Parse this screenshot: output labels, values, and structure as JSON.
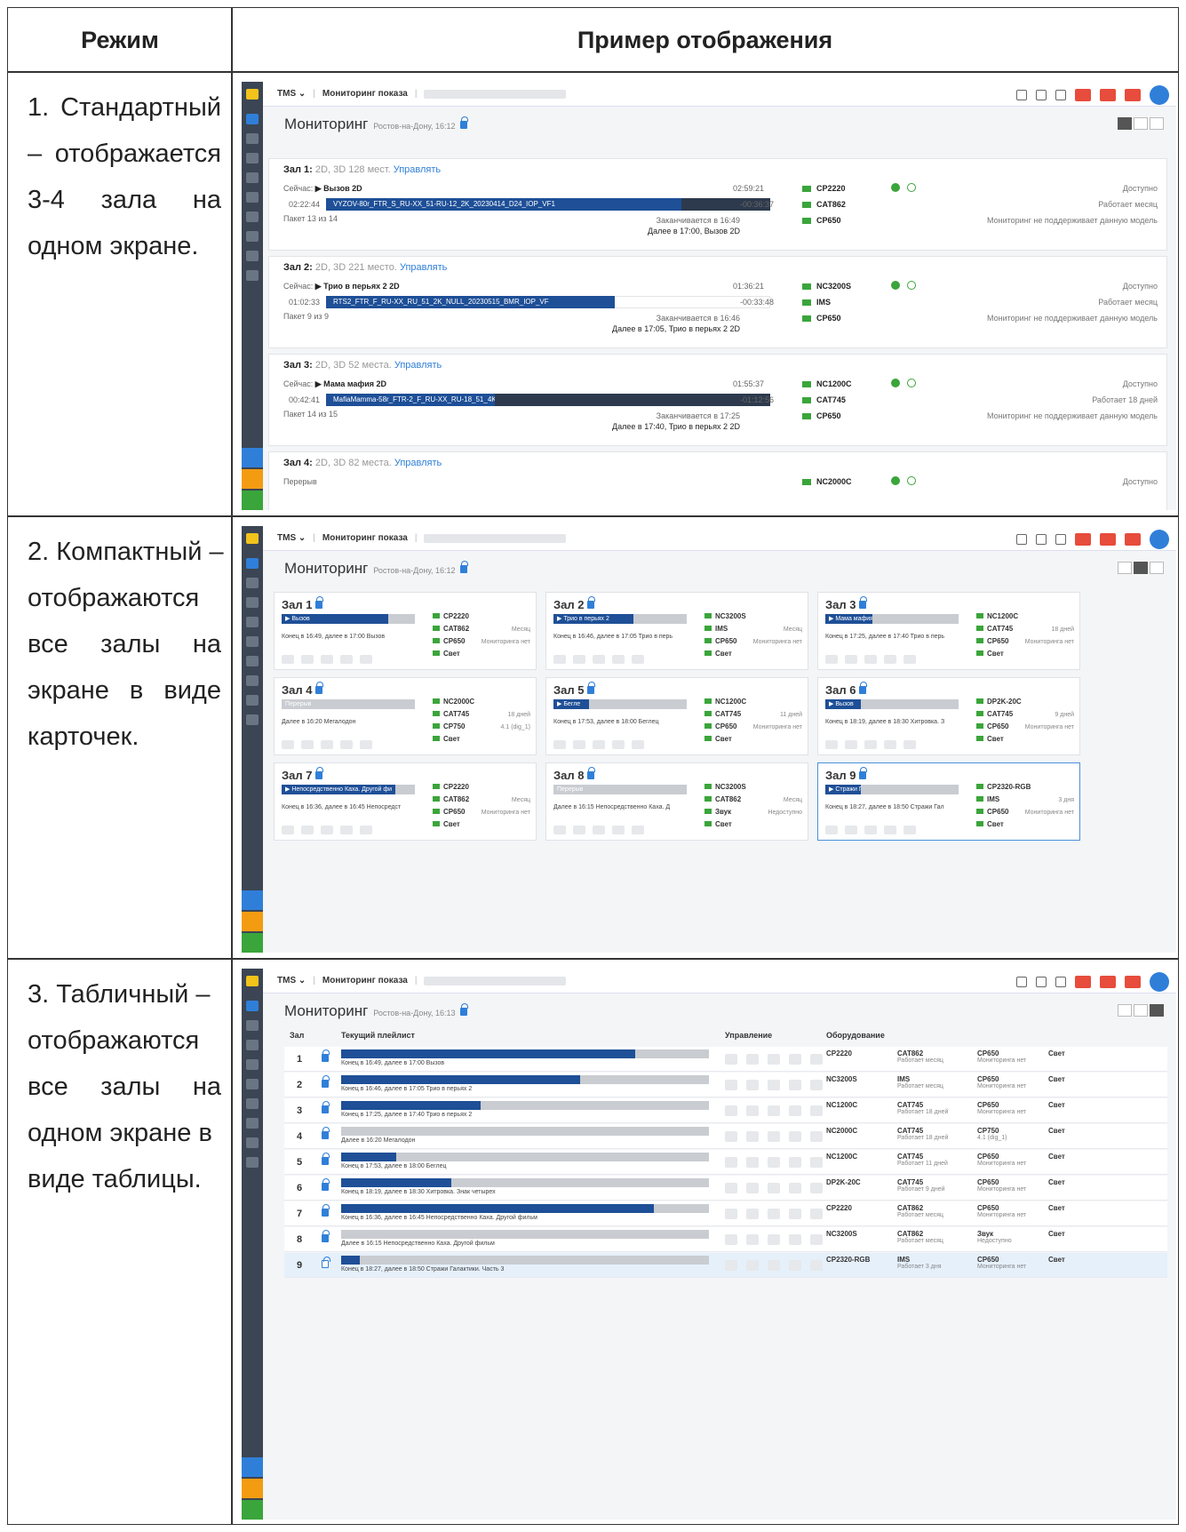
{
  "table": {
    "col1_header": "Режим",
    "col2_header": "Пример отображения",
    "rows": [
      {
        "lines": [
          [
            "1.",
            "Стандартный"
          ],
          [
            "–",
            "отображается"
          ],
          [
            "3-4",
            "зала",
            "на"
          ],
          [
            "одном экране."
          ]
        ]
      },
      {
        "lines": [
          [
            "2. Компактный –"
          ],
          [
            "отображаются"
          ],
          [
            "все",
            "залы",
            "на"
          ],
          [
            "экране",
            "в",
            "виде"
          ],
          [
            "карточек."
          ]
        ]
      },
      {
        "lines": [
          [
            "3. Табличный –"
          ],
          [
            "отображаются"
          ],
          [
            "все",
            "залы",
            "на"
          ],
          [
            "одном экране в"
          ],
          [
            "виде таблицы."
          ]
        ]
      }
    ]
  },
  "app": {
    "brand": "TMS ⌄",
    "section": "Мониторинг показа",
    "page_title": "Мониторинг",
    "city_time_1": "Ростов-на-Дону, 16:12",
    "city_time_2": "Ростов-на-Дону, 16:12",
    "city_time_3": "Ростов-на-Дону, 16:13"
  },
  "standard": {
    "halls": [
      {
        "title": "Зал 1:",
        "meta": "2D, 3D 128 мест.",
        "manage": "Управлять",
        "now_label": "Сейчас:",
        "now": "▶ Вызов 2D",
        "elapsed": "02:22:44",
        "dcp": "VYZOV-80r_FTR_S_RU-XX_51-RU-12_2K_20230414_D24_IOP_VF1",
        "remain_top": "02:59:21",
        "remain": "-00:36:37",
        "pack": "Пакет 13 из 14",
        "ends": "Заканчивается в 16:49",
        "next": "Далее в 17:00, Вызов 2D",
        "progress": 0.8,
        "eq": [
          {
            "name": "CP2220",
            "status": "Доступно"
          },
          {
            "name": "CAT862",
            "status": "Работает месяц"
          },
          {
            "name": "CP650",
            "status": "Мониторинг не поддерживает данную модель"
          }
        ]
      },
      {
        "title": "Зал 2:",
        "meta": "2D, 3D 221 место.",
        "manage": "Управлять",
        "now_label": "Сейчас:",
        "now": "▶ Трио в перьях 2 2D",
        "elapsed": "01:02:33",
        "dcp": "RTS2_FTR_F_RU-XX_RU_51_2K_NULL_20230515_BMR_IOP_VF",
        "remain_top": "01:36:21",
        "remain": "-00:33:48",
        "pack": "Пакет 9 из 9",
        "ends": "Заканчивается в 16:46",
        "next": "Далее в 17:05, Трио в перьях 2 2D",
        "progress": 0.65,
        "eq": [
          {
            "name": "NC3200S",
            "status": "Доступно"
          },
          {
            "name": "IMS",
            "status": "Работает месяц"
          },
          {
            "name": "CP650",
            "status": "Мониторинг не поддерживает данную модель"
          }
        ]
      },
      {
        "title": "Зал 3:",
        "meta": "2D, 3D 52 места.",
        "manage": "Управлять",
        "now_label": "Сейчас:",
        "now": "▶ Мама мафия 2D",
        "elapsed": "00:42:41",
        "dcp": "MafiaMamma-58r_FTR-2_F_RU-XX_RU-18_51_4K_IND_20230503_D24_IOP_VF",
        "remain_top": "01:55:37",
        "remain": "-01:12:56",
        "pack": "Пакет 14 из 15",
        "ends": "Заканчивается в 17:25",
        "next": "Далее в 17:40, Трио в перьях 2 2D",
        "progress": 0.38,
        "eq": [
          {
            "name": "NC1200C",
            "status": "Доступно"
          },
          {
            "name": "CAT745",
            "status": "Работает 18 дней"
          },
          {
            "name": "CP650",
            "status": "Мониторинг не поддерживает данную модель"
          }
        ]
      },
      {
        "title": "Зал 4:",
        "meta": "2D, 3D 82 места.",
        "manage": "Управлять",
        "now_label": "Перерыв",
        "eq": [
          {
            "name": "NC2000C",
            "status": "Доступно"
          }
        ]
      }
    ]
  },
  "compact": {
    "cards": [
      {
        "t": "Зал 1",
        "bar": "▶ Вызов",
        "info": "Конец в 16:49, далее в 17:00 Вызов",
        "e1": "CP2220",
        "e2": "CAT862",
        "e3": "CP650",
        "e4": "Свет",
        "r2": "Месяц",
        "r3": "Мониторинга нет",
        "p": 0.8,
        "g": false
      },
      {
        "t": "Зал 2",
        "bar": "▶ Трио в перьях 2",
        "info": "Конец в 16:46, далее в 17:05 Трио в перь",
        "e1": "NC3200S",
        "e2": "IMS",
        "e3": "CP650",
        "e4": "Свет",
        "r2": "Месяц",
        "r3": "Мониторинга нет",
        "p": 0.6,
        "g": false
      },
      {
        "t": "Зал 3",
        "bar": "▶ Мама мафия",
        "info": "Конец в 17:25, далее в 17:40 Трио в перь",
        "e1": "NC1200C",
        "e2": "CAT745",
        "e3": "CP650",
        "e4": "Свет",
        "r2": "18 дней",
        "r3": "Мониторинга нет",
        "p": 0.35,
        "g": false
      },
      {
        "t": "Зал 4",
        "bar": "Перерыв",
        "info": "Далее в 16:20 Мегалодон",
        "e1": "NC2000C",
        "e2": "CAT745",
        "e3": "CP750",
        "e4": "Свет",
        "r2": "18 дней",
        "r3": "4.1 (dig_1)",
        "p": 0,
        "g": true
      },
      {
        "t": "Зал 5",
        "bar": "▶ Бегле",
        "info": "Конец в 17:53, далее в 18:00 Беглец",
        "e1": "NC1200C",
        "e2": "CAT745",
        "e3": "CP650",
        "e4": "Свет",
        "r2": "11 дней",
        "r3": "Мониторинга нет",
        "p": 0.2,
        "g": false
      },
      {
        "t": "Зал 6",
        "bar": "▶ Вызов",
        "info": "Конец в 18:19, далее в 18:30 Хитровка. З",
        "e1": "DP2K-20C",
        "e2": "CAT745",
        "e3": "CP650",
        "e4": "Свет",
        "r2": "9 дней",
        "r3": "Мониторинга нет",
        "p": 0.25,
        "g": false
      },
      {
        "t": "Зал 7",
        "bar": "▶ Непосредственно Каха. Другой фи",
        "info": "Конец в 16:36, далее в 16:45 Непосредст",
        "e1": "CP2220",
        "e2": "CAT862",
        "e3": "CP650",
        "e4": "Свет",
        "r2": "Месяц",
        "r3": "Мониторинга нет",
        "p": 0.85,
        "g": false
      },
      {
        "t": "Зал 8",
        "bar": "Перерыв",
        "info": "Далее в 16:15 Непосредственно Каха. Д",
        "e1": "NC3200S",
        "e2": "CAT862",
        "e3": "Звук",
        "e4": "Свет",
        "r2": "Месяц",
        "r3": "Недоступно",
        "p": 0,
        "g": true
      },
      {
        "t": "Зал 9",
        "bar": "▶ Стражи Галактики. Часть 3",
        "info": "Конец в 18:27, далее в 18:50 Стражи Гал",
        "e1": "CP2320-RGB",
        "e2": "IMS",
        "e3": "CP650",
        "e4": "Свет",
        "r2": "3 дня",
        "r3": "Мониторинга нет",
        "p": 0.05,
        "g": false
      }
    ]
  },
  "tabular": {
    "h_hall": "Зал",
    "h_playlist": "Текущий плейлист",
    "h_ctrl": "Управление",
    "h_eq": "Оборудование",
    "rows": [
      {
        "n": "1",
        "txt": "Конец в 16:49, далее в 17:00 Вызов",
        "p": 0.8,
        "e1": "CP2220",
        "e2": "CAT862",
        "e2s": "Работает месяц",
        "e3": "CP650",
        "e3s": "Мониторинга нет",
        "e4": "Свет"
      },
      {
        "n": "2",
        "txt": "Конец в 16:46, далее в 17:05 Трио в перьях 2",
        "p": 0.65,
        "e1": "NC3200S",
        "e2": "IMS",
        "e2s": "Работает месяц",
        "e3": "CP650",
        "e3s": "Мониторинга нет",
        "e4": "Свет"
      },
      {
        "n": "3",
        "txt": "Конец в 17:25, далее в 17:40 Трио в перьях 2",
        "p": 0.38,
        "e1": "NC1200C",
        "e2": "CAT745",
        "e2s": "Работает 18 дней",
        "e3": "CP650",
        "e3s": "Мониторинга нет",
        "e4": "Свет"
      },
      {
        "n": "4",
        "txt": "Далее в 16:20 Мегалодон",
        "p": 0,
        "e1": "NC2000C",
        "e2": "CAT745",
        "e2s": "Работает 18 дней",
        "e3": "CP750",
        "e3s": "4.1 (dig_1)",
        "e4": "Свет"
      },
      {
        "n": "5",
        "txt": "Конец в 17:53, далее в 18:00 Беглец",
        "p": 0.15,
        "e1": "NC1200C",
        "e2": "CAT745",
        "e2s": "Работает 11 дней",
        "e3": "CP650",
        "e3s": "Мониторинга нет",
        "e4": "Свет"
      },
      {
        "n": "6",
        "txt": "Конец в 18:19, далее в 18:30 Хитровка. Знак четырех",
        "p": 0.3,
        "e1": "DP2K-20C",
        "e2": "CAT745",
        "e2s": "Работает 9 дней",
        "e3": "CP650",
        "e3s": "Мониторинга нет",
        "e4": "Свет"
      },
      {
        "n": "7",
        "txt": "Конец в 16:36, далее в 16:45 Непосредственно Каха. Другой фильм",
        "p": 0.85,
        "e1": "CP2220",
        "e2": "CAT862",
        "e2s": "Работает месяц",
        "e3": "CP650",
        "e3s": "Мониторинга нет",
        "e4": "Свет"
      },
      {
        "n": "8",
        "txt": "Далее в 16:15 Непосредственно Каха. Другой фильм",
        "p": 0,
        "e1": "NC3200S",
        "e2": "CAT862",
        "e2s": "Работает месяц",
        "e3": "Звук",
        "e3s": "Недоступно",
        "e4": "Свет"
      },
      {
        "n": "9",
        "txt": "Конец в 18:27, далее в 18:50 Стражи Галактики. Часть 3",
        "p": 0.05,
        "e1": "CP2320-RGB",
        "e2": "IMS",
        "e2s": "Работает 3 дня",
        "e3": "CP650",
        "e3s": "Мониторинга нет",
        "e4": "Свет"
      }
    ]
  }
}
